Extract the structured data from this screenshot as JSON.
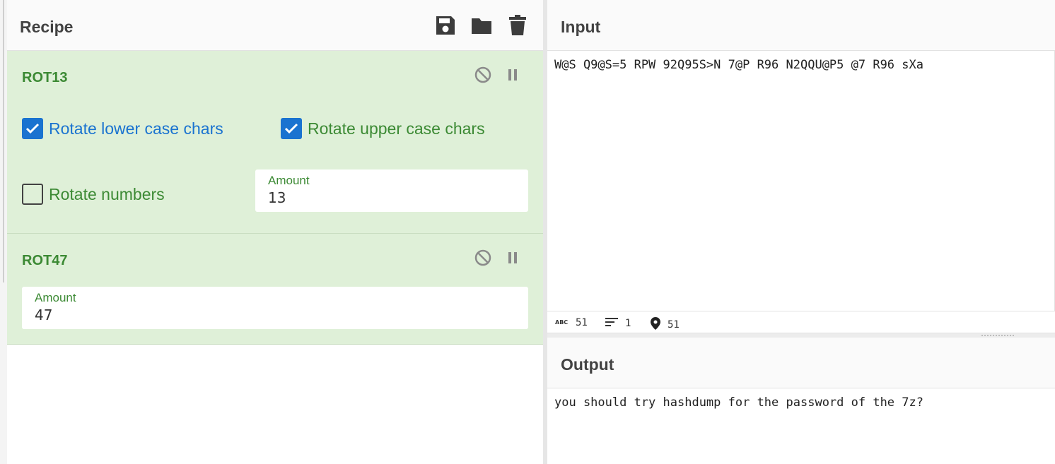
{
  "recipe": {
    "title": "Recipe",
    "header_icons": [
      "save-icon",
      "folder-open-icon",
      "trash-icon"
    ],
    "operations": [
      {
        "name": "ROT13",
        "options": {
          "rotate_lower": {
            "label": "Rotate lower case chars",
            "checked": true
          },
          "rotate_upper": {
            "label": "Rotate upper case chars",
            "checked": true
          },
          "rotate_numbers": {
            "label": "Rotate numbers",
            "checked": false
          },
          "amount": {
            "label": "Amount",
            "value": "13"
          }
        }
      },
      {
        "name": "ROT47",
        "options": {
          "amount": {
            "label": "Amount",
            "value": "47"
          }
        }
      }
    ]
  },
  "input": {
    "title": "Input",
    "text": "W@S Q9@S=5 RPW 92Q95S>N 7@P R96 N2QQU@P5 @7 R96 sXa",
    "status": {
      "chars": "51",
      "lines": "1",
      "position": "51"
    }
  },
  "output": {
    "title": "Output",
    "text": "you should try hashdump for the password of the 7z?"
  },
  "colors": {
    "op_bg": "#dff0d8",
    "op_text": "#3c8a34",
    "checkbox_blue": "#1a73d0",
    "lower_label_blue": "#1a73d0"
  }
}
